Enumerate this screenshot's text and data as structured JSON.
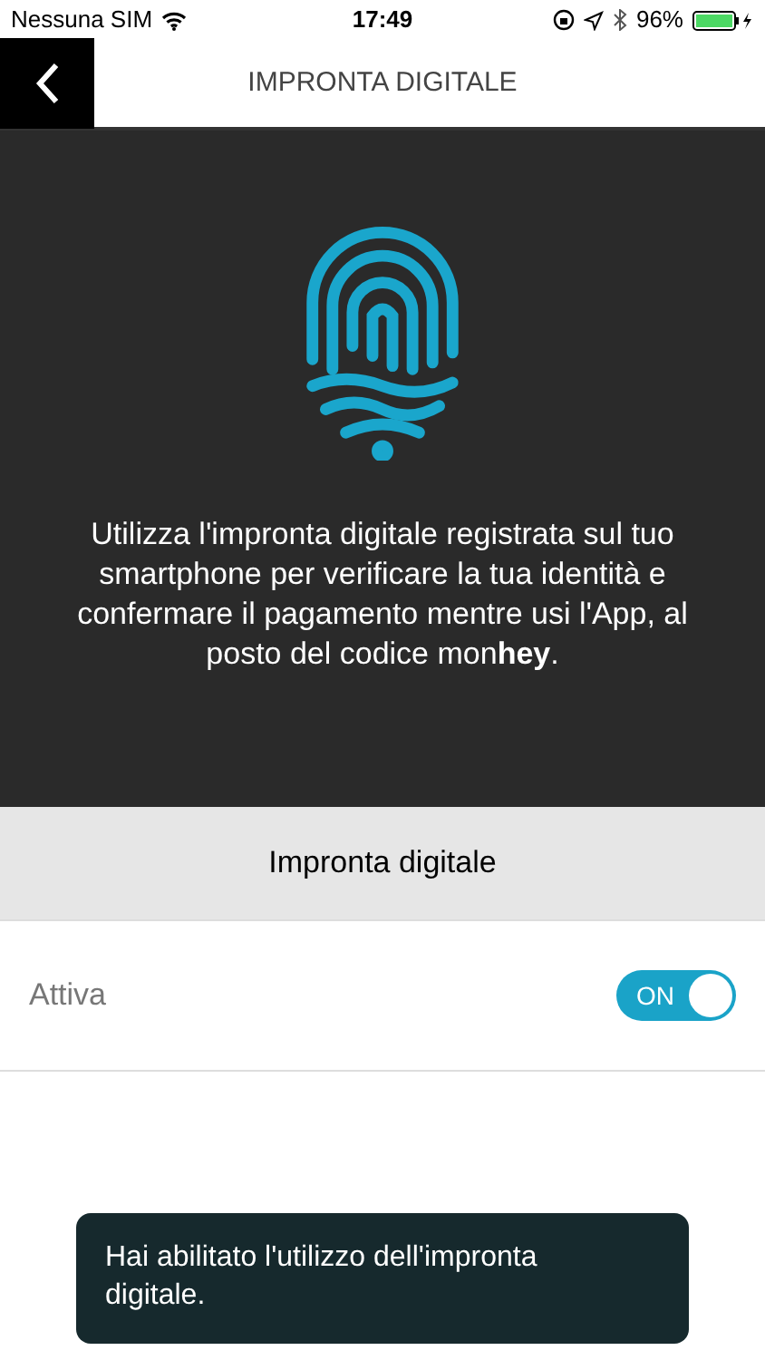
{
  "status_bar": {
    "carrier": "Nessuna SIM",
    "time": "17:49",
    "battery": "96%"
  },
  "nav_bar": {
    "title": "IMPRONTA DIGITALE"
  },
  "intro": {
    "text": "Utilizza l'impronta digitale registrata sul tuo smartphone per verificare la tua identità e confermare il pagamento mentre usi l'App, al posto del codice mon**hey**."
  },
  "section": {
    "title": "Impronta digitale"
  },
  "setting": {
    "label": "Attiva",
    "on": true,
    "toggle_label": "ON"
  },
  "toast": {
    "text": "Hai abilitato l'utilizzo dell'impronta digitale."
  }
}
